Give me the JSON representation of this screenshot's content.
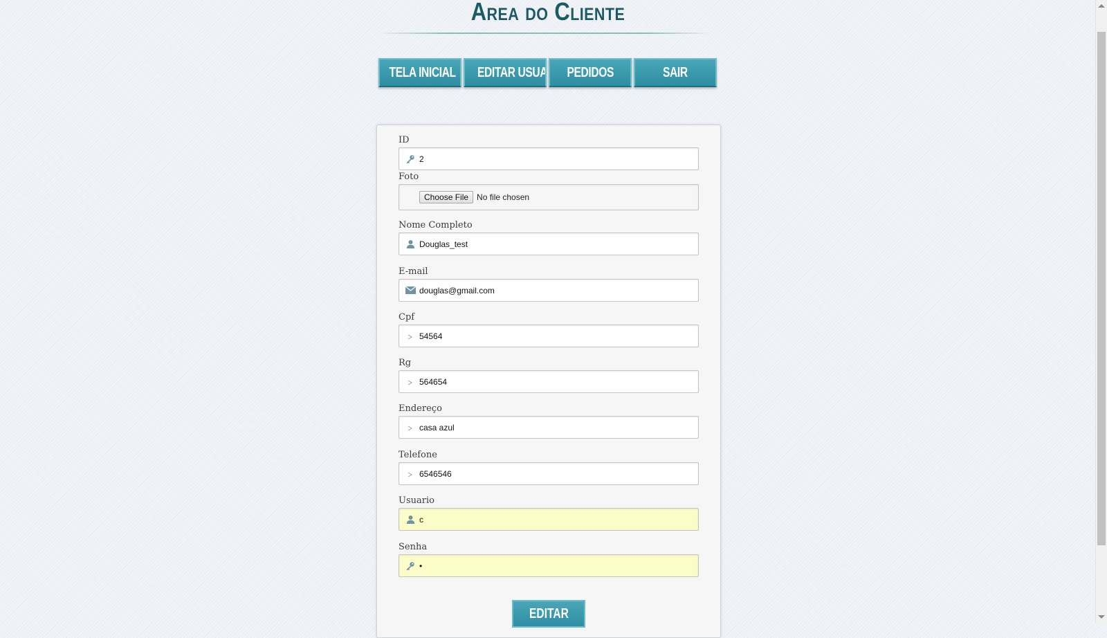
{
  "header": {
    "title": "Area do Cliente"
  },
  "nav": [
    {
      "label": "Tela Inicial"
    },
    {
      "label": "Editar Usuario"
    },
    {
      "label": "Pedidos"
    },
    {
      "label": "Sair"
    }
  ],
  "form": {
    "id": {
      "label": "ID",
      "value": "2",
      "icon": "key-icon"
    },
    "foto": {
      "label": "Foto",
      "button": "Choose File",
      "status": "No file chosen"
    },
    "nome": {
      "label": "Nome Completo",
      "value": "Douglas_test",
      "icon": "user-icon"
    },
    "email": {
      "label": "E-mail",
      "value": "douglas@gmail.com",
      "icon": "envelope-icon"
    },
    "cpf": {
      "label": "Cpf",
      "value": "54564",
      "icon": "chevron-icon"
    },
    "rg": {
      "label": "Rg",
      "value": "564654",
      "icon": "chevron-icon"
    },
    "endereco": {
      "label": "Endereço",
      "value": "casa azul",
      "icon": "chevron-icon"
    },
    "telefone": {
      "label": "Telefone",
      "value": "6546546",
      "icon": "chevron-icon"
    },
    "usuario": {
      "label": "Usuario",
      "value": "c",
      "icon": "user-icon"
    },
    "senha": {
      "label": "Senha",
      "value": "•",
      "icon": "key-icon"
    },
    "submit": "Editar"
  },
  "colors": {
    "accent": "#3a9db0",
    "title": "#1d5a66",
    "autofill": "#fbfcc7"
  }
}
